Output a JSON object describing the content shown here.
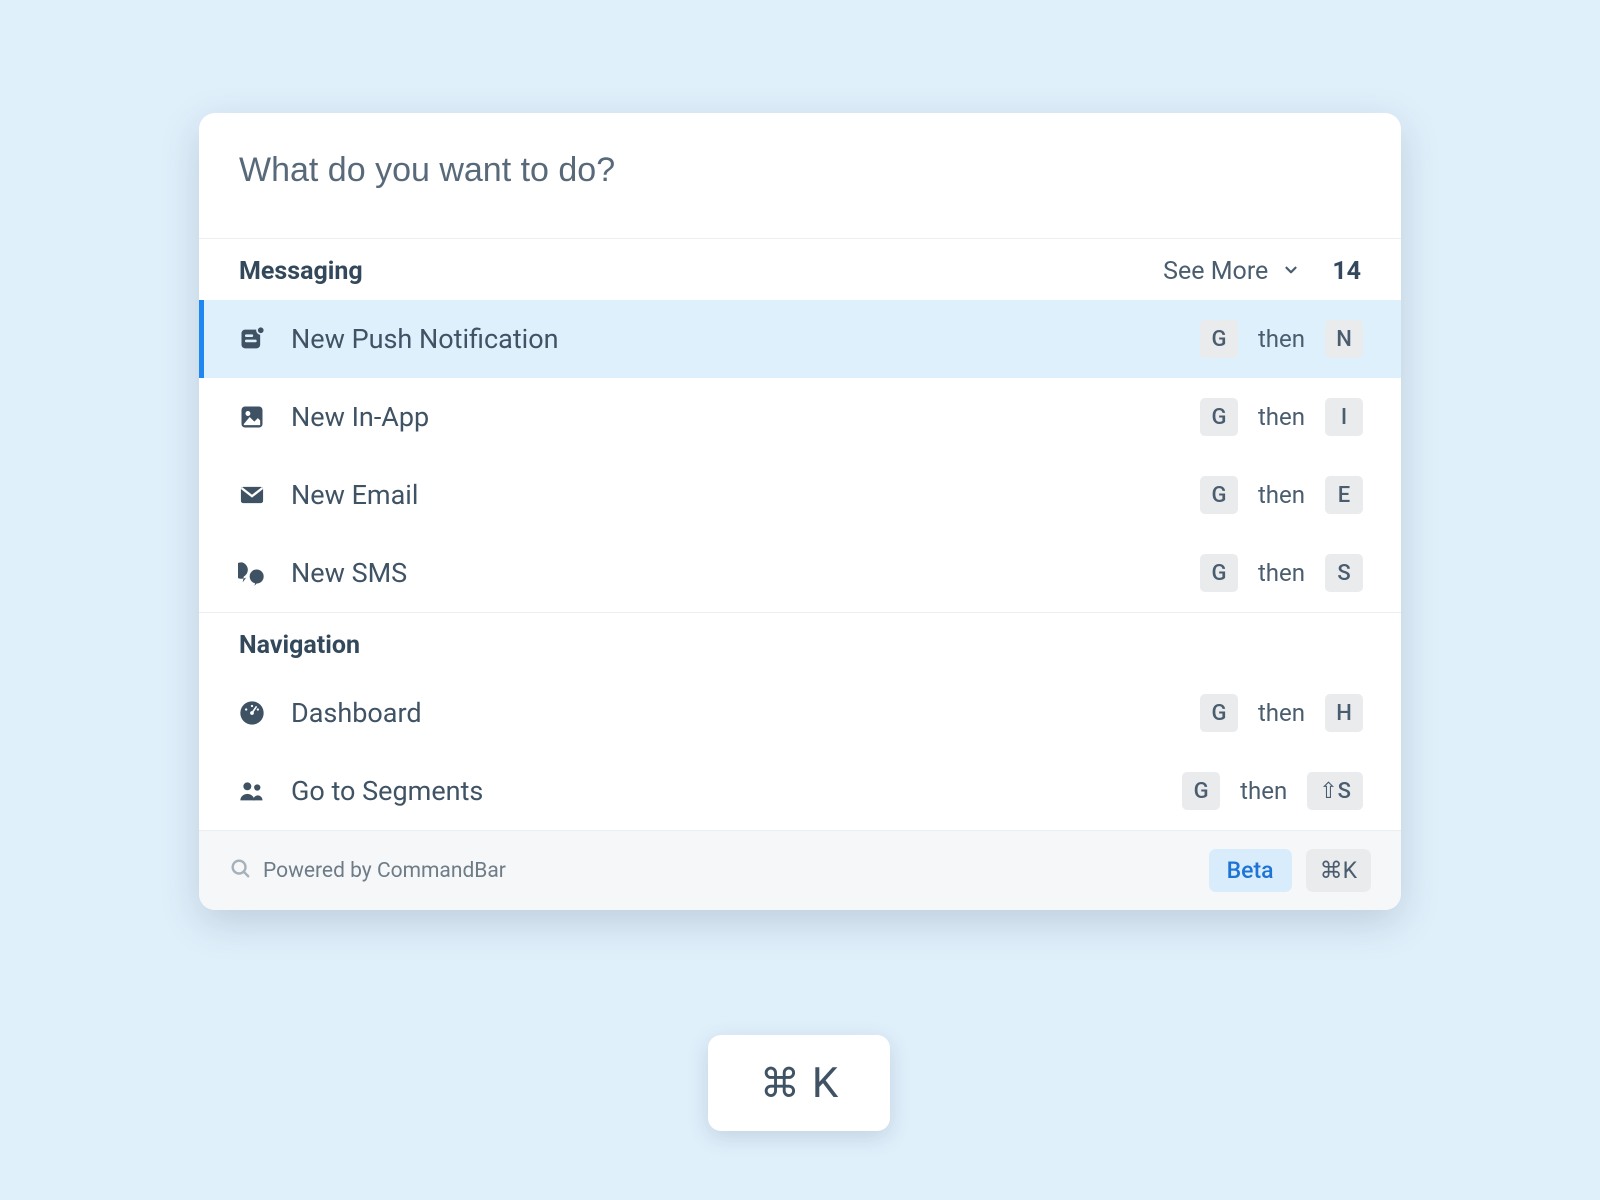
{
  "search": {
    "placeholder": "What do you want to do?",
    "value": ""
  },
  "sections": {
    "messaging": {
      "title": "Messaging",
      "see_more_label": "See More",
      "see_more_count": "14",
      "items": [
        {
          "label": "New Push Notification",
          "icon": "push-notification-icon",
          "shortcut": {
            "k1": "G",
            "then": "then",
            "k2": "N"
          },
          "selected": true
        },
        {
          "label": "New In-App",
          "icon": "in-app-icon",
          "shortcut": {
            "k1": "G",
            "then": "then",
            "k2": "I"
          }
        },
        {
          "label": "New Email",
          "icon": "email-icon",
          "shortcut": {
            "k1": "G",
            "then": "then",
            "k2": "E"
          }
        },
        {
          "label": "New SMS",
          "icon": "sms-icon",
          "shortcut": {
            "k1": "G",
            "then": "then",
            "k2": "S"
          }
        }
      ]
    },
    "navigation": {
      "title": "Navigation",
      "items": [
        {
          "label": "Dashboard",
          "icon": "dashboard-icon",
          "shortcut": {
            "k1": "G",
            "then": "then",
            "k2": "H"
          }
        },
        {
          "label": "Go to Segments",
          "icon": "segments-icon",
          "shortcut": {
            "k1": "G",
            "then": "then",
            "k2": "⇧S"
          }
        }
      ]
    }
  },
  "footer": {
    "powered_by": "Powered by CommandBar",
    "beta_label": "Beta",
    "shortcut": "⌘K"
  },
  "hint": {
    "cmd": "⌘",
    "key": "K"
  }
}
